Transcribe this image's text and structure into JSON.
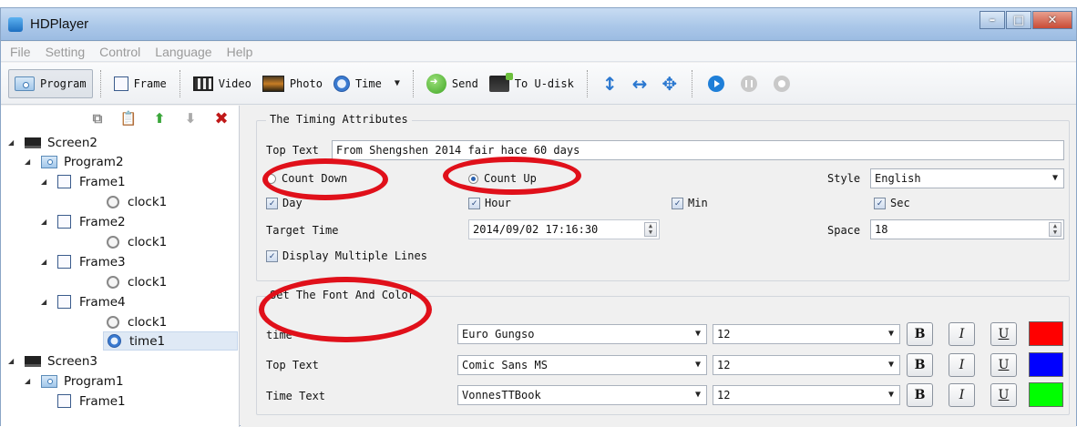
{
  "window": {
    "title": "HDPlayer"
  },
  "menu": [
    "File",
    "Setting",
    "Control",
    "Language",
    "Help"
  ],
  "toolbar": {
    "program": "Program",
    "frame": "Frame",
    "video": "Video",
    "photo": "Photo",
    "time": "Time",
    "send": "Send",
    "udisk": "To U-disk"
  },
  "tree": [
    {
      "label": "Screen2",
      "type": "screen"
    },
    {
      "label": "Program2",
      "type": "program"
    },
    {
      "label": "Frame1",
      "type": "frame"
    },
    {
      "label": "clock1",
      "type": "clock"
    },
    {
      "label": "Frame2",
      "type": "frame"
    },
    {
      "label": "clock1",
      "type": "clock"
    },
    {
      "label": "Frame3",
      "type": "frame"
    },
    {
      "label": "clock1",
      "type": "clock"
    },
    {
      "label": "Frame4",
      "type": "frame"
    },
    {
      "label": "clock1",
      "type": "clock"
    },
    {
      "label": "time1",
      "type": "time",
      "selected": true
    },
    {
      "label": "Screen3",
      "type": "screen"
    },
    {
      "label": "Program1",
      "type": "program"
    },
    {
      "label": "Frame1",
      "type": "frame"
    }
  ],
  "timing": {
    "title": "The Timing Attributes",
    "top_text_label": "Top Text",
    "top_text_value": "From Shengshen 2014 fair hace 60 days",
    "count_down": "Count Down",
    "count_up": "Count Up",
    "selected_mode": "Count Up",
    "style_label": "Style",
    "style_value": "English",
    "day": "Day",
    "hour": "Hour",
    "min": "Min",
    "sec": "Sec",
    "target_label": "Target Time",
    "target_value": "2014/09/02 17:16:30",
    "space_label": "Space",
    "space_value": "18",
    "multi_lines": "Display Multiple Lines"
  },
  "font_color": {
    "title": "Set The Font And Color",
    "rows": [
      {
        "label": "time",
        "font": "Euro Gungso",
        "size": "12",
        "color": "#ff0000"
      },
      {
        "label": "Top Text",
        "font": "Comic Sans MS",
        "size": "12",
        "color": "#0000ff"
      },
      {
        "label": "Time Text",
        "font": "VonnesTTBook",
        "size": "12",
        "color": "#00ff00"
      }
    ],
    "bold": "B",
    "italic": "I",
    "underline": "U"
  }
}
